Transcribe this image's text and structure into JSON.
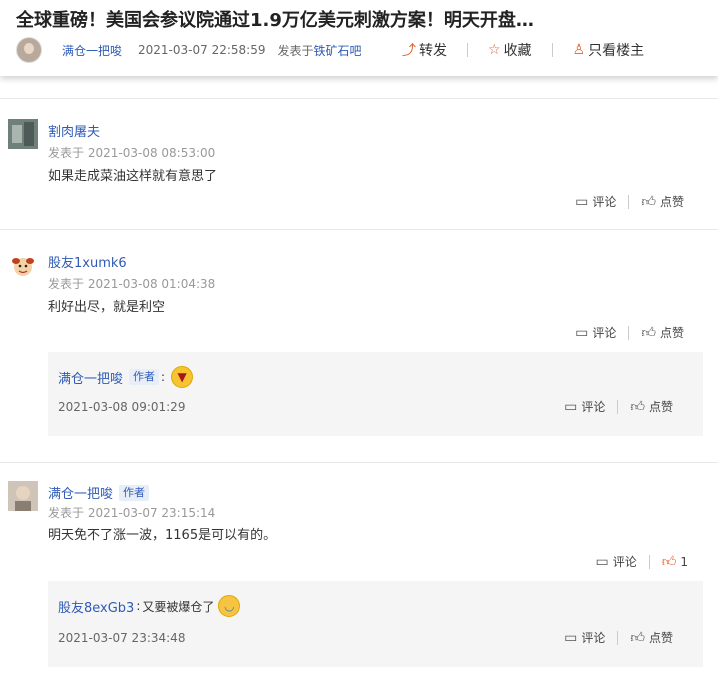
{
  "thread": {
    "title": "全球重磅！美国会参议院通过1.9万亿美元刺激方案！明天开盘…",
    "author": "满仓一把唆",
    "date": "2021-03-07 22:58:59",
    "from_prefix": "发表于",
    "from_board": "铁矿石吧",
    "forward_label": "转发",
    "favorite_label": "收藏",
    "only_author_label": "只看楼主"
  },
  "common": {
    "posted_prefix": "发表于",
    "comment_label": "评论",
    "like_label": "点赞",
    "author_tag": "作者"
  },
  "posts": [
    {
      "user": "割肉屠夫",
      "time": "2021-03-08 08:53:00",
      "content": "如果走成菜油这样就有意思了"
    },
    {
      "user": "股友1xumk6",
      "time": "2021-03-08 01:04:38",
      "content": "利好出尽，就是利空",
      "reply": {
        "user": "满仓一把唆",
        "text": "",
        "date": "2021-03-08 09:01:29"
      }
    },
    {
      "user": "满仓一把唆",
      "time": "2021-03-07 23:15:14",
      "content": "明天免不了涨一波，1165是可以有的。",
      "like_count": "1",
      "reply": {
        "user": "股友8exGb3",
        "text": "又要被爆仓了",
        "date": "2021-03-07 23:34:48"
      }
    }
  ],
  "colors": {
    "link": "#2f5bb6",
    "accent": "#e0602b"
  }
}
